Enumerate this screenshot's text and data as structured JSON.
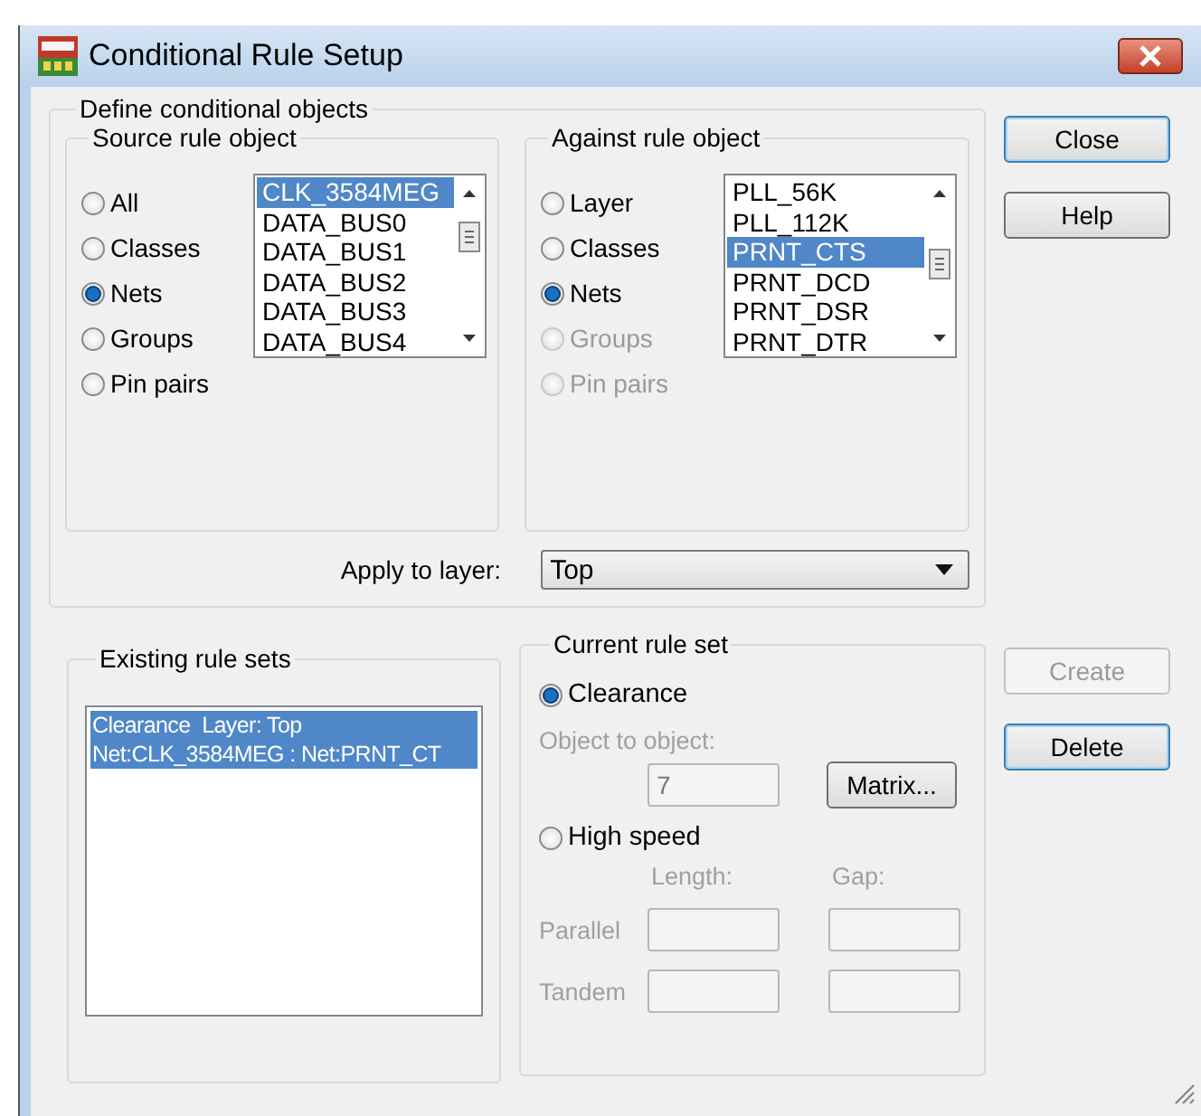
{
  "window": {
    "title": "Conditional Rule Setup"
  },
  "define_group": {
    "title": "Define conditional objects"
  },
  "source": {
    "title": "Source rule object",
    "options": [
      {
        "label": "All",
        "selected": false,
        "disabled": false
      },
      {
        "label": "Classes",
        "selected": false,
        "disabled": false
      },
      {
        "label": "Nets",
        "selected": true,
        "disabled": false
      },
      {
        "label": "Groups",
        "selected": false,
        "disabled": false
      },
      {
        "label": "Pin pairs",
        "selected": false,
        "disabled": false
      }
    ],
    "list": [
      {
        "label": "CLK_3584MEG",
        "selected": true
      },
      {
        "label": "DATA_BUS0",
        "selected": false
      },
      {
        "label": "DATA_BUS1",
        "selected": false
      },
      {
        "label": "DATA_BUS2",
        "selected": false
      },
      {
        "label": "DATA_BUS3",
        "selected": false
      },
      {
        "label": "DATA_BUS4",
        "selected": false
      }
    ]
  },
  "against": {
    "title": "Against rule object",
    "options": [
      {
        "label": "Layer",
        "selected": false,
        "disabled": false
      },
      {
        "label": "Classes",
        "selected": false,
        "disabled": false
      },
      {
        "label": "Nets",
        "selected": true,
        "disabled": false
      },
      {
        "label": "Groups",
        "selected": false,
        "disabled": true
      },
      {
        "label": "Pin pairs",
        "selected": false,
        "disabled": true
      }
    ],
    "list": [
      {
        "label": "PLL_56K",
        "selected": false
      },
      {
        "label": "PLL_112K",
        "selected": false
      },
      {
        "label": "PRNT_CTS",
        "selected": true
      },
      {
        "label": "PRNT_DCD",
        "selected": false
      },
      {
        "label": "PRNT_DSR",
        "selected": false
      },
      {
        "label": "PRNT_DTR",
        "selected": false
      }
    ]
  },
  "apply_to_layer": {
    "label": "Apply to layer:",
    "value": "Top"
  },
  "buttons": [
    {
      "label": "Close",
      "disabled": false,
      "default": true
    },
    {
      "label": "Help",
      "disabled": false,
      "default": false
    }
  ],
  "existing_rule_sets": {
    "title": "Existing rule sets",
    "items": [
      {
        "lines": [
          "Clearance  Layer: Top",
          "Net:CLK_3584MEG : Net:PRNT_CT"
        ],
        "selected": true
      }
    ]
  },
  "current_rule_set": {
    "title": "Current rule set",
    "modes": [
      {
        "label": "Clearance",
        "selected": true
      },
      {
        "label": "High speed",
        "selected": false
      }
    ],
    "object_label": "Object to object:",
    "object_value": "7",
    "object_disabled": true,
    "matrix_button": "Matrix...",
    "length_label": "Length:",
    "gap_label": "Gap:",
    "high_speed_disabled": true,
    "rows": [
      {
        "label": "Parallel"
      },
      {
        "label": "Tandem"
      }
    ]
  },
  "side_buttons": [
    {
      "label": "Create",
      "disabled": true,
      "default": false
    },
    {
      "label": "Delete",
      "disabled": false,
      "default": true
    }
  ]
}
